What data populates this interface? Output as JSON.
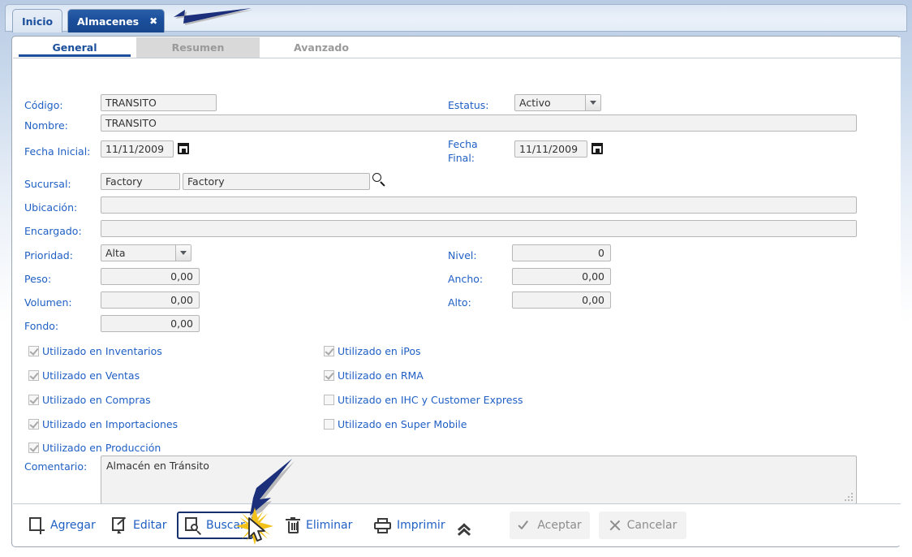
{
  "window": {
    "tabs": [
      {
        "label": "Inicio",
        "active": false,
        "closable": false
      },
      {
        "label": "Almacenes",
        "active": true,
        "closable": true,
        "close_glyph": "✖"
      }
    ]
  },
  "inner_tabs": [
    {
      "label": "General",
      "state": "selected"
    },
    {
      "label": "Resumen",
      "state": "unselected"
    },
    {
      "label": "Avanzado",
      "state": "plain"
    }
  ],
  "form": {
    "codigo": {
      "label": "Código:",
      "value": "TRANSITO"
    },
    "nombre": {
      "label": "Nombre:",
      "value": "TRANSITO"
    },
    "fecha_inicial": {
      "label": "Fecha Inicial:",
      "value": "11/11/2009"
    },
    "sucursal": {
      "label": "Sucursal:",
      "code": "Factory",
      "name": "Factory"
    },
    "ubicacion": {
      "label": "Ubicación:",
      "value": ""
    },
    "encargado": {
      "label": "Encargado:",
      "value": ""
    },
    "prioridad": {
      "label": "Prioridad:",
      "value": "Alta"
    },
    "peso": {
      "label": "Peso:",
      "value": "0,00"
    },
    "volumen": {
      "label": "Volumen:",
      "value": "0,00"
    },
    "fondo": {
      "label": "Fondo:",
      "value": "0,00"
    },
    "estatus": {
      "label": "Estatus:",
      "value": "Activo"
    },
    "fecha_final": {
      "label_line1": "Fecha",
      "label_line2": "Final:",
      "value": "11/11/2009"
    },
    "nivel": {
      "label": "Nivel:",
      "value": "0"
    },
    "ancho": {
      "label": "Ancho:",
      "value": "0,00"
    },
    "alto": {
      "label": "Alto:",
      "value": "0,00"
    },
    "comentario": {
      "label": "Comentario:",
      "value": "Almacén en Tránsito"
    }
  },
  "checkboxes_left": [
    {
      "label": "Utilizado en Inventarios",
      "checked": true
    },
    {
      "label": "Utilizado en Ventas",
      "checked": true
    },
    {
      "label": "Utilizado en Compras",
      "checked": true
    },
    {
      "label": "Utilizado en Importaciones",
      "checked": true
    },
    {
      "label": "Utilizado en Producción",
      "checked": true
    }
  ],
  "checkboxes_right": [
    {
      "label": "Utilizado en iPos",
      "checked": true
    },
    {
      "label": "Utilizado en RMA",
      "checked": true
    },
    {
      "label": "Utilizado en IHC y Customer Express",
      "checked": false
    },
    {
      "label": "Utilizado en Super Mobile",
      "checked": false
    }
  ],
  "toolbar": {
    "agregar": "Agregar",
    "editar": "Editar",
    "buscar": "Buscar",
    "eliminar": "Eliminar",
    "imprimir": "Imprimir",
    "aceptar": "Aceptar",
    "cancelar": "Cancelar"
  },
  "colors": {
    "accent_blue": "#1f5fc4",
    "tab_active_blue": "#1b4f9c",
    "annotation_navy": "#1b2f7a",
    "burst_yellow": "#f2c21a",
    "field_bg": "#f2f2f2",
    "disabled_text": "#8d8d8d"
  }
}
